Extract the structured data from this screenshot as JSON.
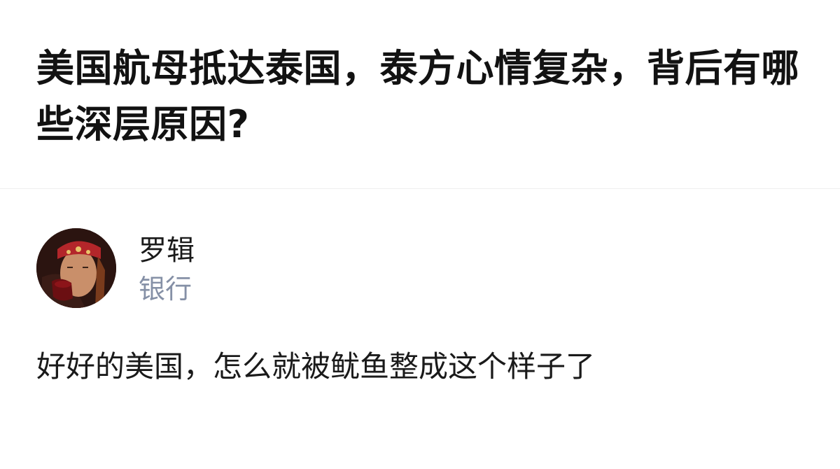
{
  "question": {
    "title": "美国航母抵达泰国，泰方心情复杂，背后有哪些深层原因?"
  },
  "answer": {
    "author": {
      "name": "罗辑",
      "headline": "银行",
      "avatar_icon": "user-avatar-photo"
    },
    "content": "好好的美国，怎么就被鱿鱼整成这个样子了"
  },
  "colors": {
    "title": "#121212",
    "body_text": "#1a1a1a",
    "headline": "#8590a6",
    "divider": "#eeeeee",
    "background": "#ffffff"
  }
}
